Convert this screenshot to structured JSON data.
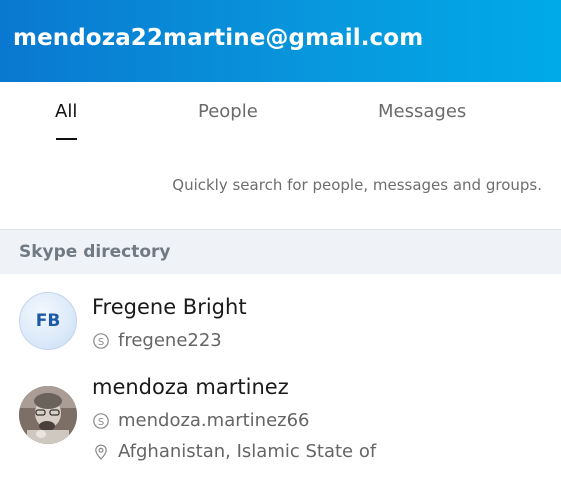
{
  "header": {
    "title": "mendoza22martine@gmail.com"
  },
  "tabs": [
    {
      "label": "All",
      "active": true
    },
    {
      "label": "People",
      "active": false
    },
    {
      "label": "Messages",
      "active": false
    }
  ],
  "search_hint": "Quickly search for people, messages and groups.",
  "directory": {
    "title": "Skype directory",
    "results": [
      {
        "name": "Fregene Bright",
        "initials": "FB",
        "skype_id": "fregene223",
        "avatar": "initials"
      },
      {
        "name": "mendoza martinez",
        "skype_id": "mendoza.martinez66",
        "location": "Afghanistan, Islamic State of",
        "avatar": "photo"
      }
    ]
  },
  "colors": {
    "header_gradient_start": "#0a78d0",
    "header_gradient_end": "#00aae8",
    "initials_text": "#1d5aa8",
    "section_bg": "#eff2f6"
  },
  "icons": {
    "skype": "skype-icon",
    "location": "location-pin-icon"
  }
}
